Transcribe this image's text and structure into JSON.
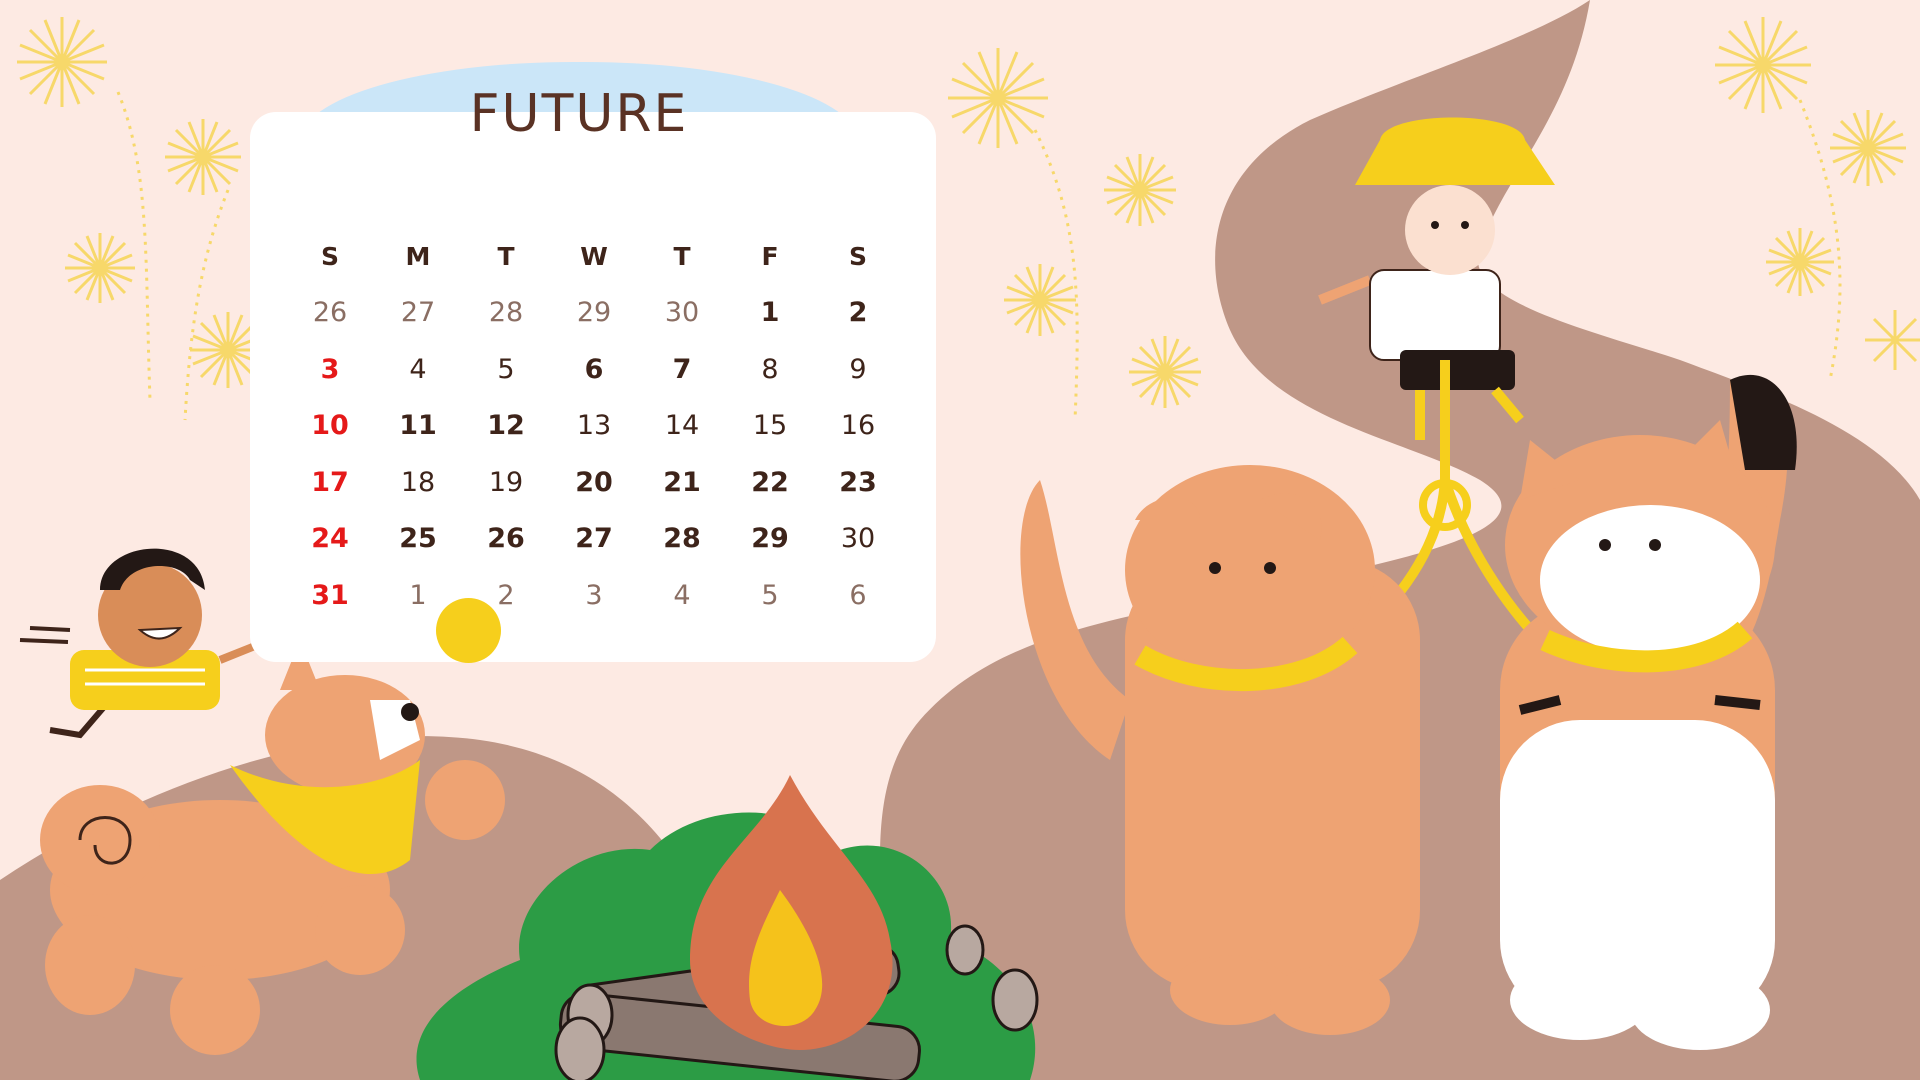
{
  "calendar": {
    "title": "FUTURE",
    "weekdays": [
      "S",
      "M",
      "T",
      "W",
      "T",
      "F",
      "S"
    ],
    "weeks": [
      [
        {
          "d": "26",
          "s": "muted"
        },
        {
          "d": "27",
          "s": "muted"
        },
        {
          "d": "28",
          "s": "muted"
        },
        {
          "d": "29",
          "s": "muted"
        },
        {
          "d": "30",
          "s": "muted"
        },
        {
          "d": "1",
          "s": ""
        },
        {
          "d": "2",
          "s": ""
        }
      ],
      [
        {
          "d": "3",
          "s": "red"
        },
        {
          "d": "4",
          "s": "lite"
        },
        {
          "d": "5",
          "s": "lite"
        },
        {
          "d": "6",
          "s": ""
        },
        {
          "d": "7",
          "s": ""
        },
        {
          "d": "8",
          "s": "lite"
        },
        {
          "d": "9",
          "s": "lite"
        }
      ],
      [
        {
          "d": "10",
          "s": "red"
        },
        {
          "d": "11",
          "s": ""
        },
        {
          "d": "12",
          "s": ""
        },
        {
          "d": "13",
          "s": "lite"
        },
        {
          "d": "14",
          "s": "lite"
        },
        {
          "d": "15",
          "s": "lite"
        },
        {
          "d": "16",
          "s": "lite"
        }
      ],
      [
        {
          "d": "17",
          "s": "red"
        },
        {
          "d": "18",
          "s": "lite"
        },
        {
          "d": "19",
          "s": "lite"
        },
        {
          "d": "20",
          "s": ""
        },
        {
          "d": "21",
          "s": ""
        },
        {
          "d": "22",
          "s": ""
        },
        {
          "d": "23",
          "s": ""
        }
      ],
      [
        {
          "d": "24",
          "s": "red"
        },
        {
          "d": "25",
          "s": ""
        },
        {
          "d": "26",
          "s": ""
        },
        {
          "d": "27",
          "s": ""
        },
        {
          "d": "28",
          "s": ""
        },
        {
          "d": "29",
          "s": ""
        },
        {
          "d": "30",
          "s": "lite"
        }
      ],
      [
        {
          "d": "31",
          "s": "red"
        },
        {
          "d": "1",
          "s": "muted"
        },
        {
          "d": "2",
          "s": "muted"
        },
        {
          "d": "3",
          "s": "muted"
        },
        {
          "d": "4",
          "s": "muted"
        },
        {
          "d": "5",
          "s": "muted"
        },
        {
          "d": "6",
          "s": "muted"
        }
      ]
    ]
  },
  "colors": {
    "background": "#fdeae3",
    "hill": "#bf9787",
    "path": "#b38c7c",
    "sun_ball": "#f6cf1c",
    "cloud": "#cbe6f8",
    "weekend_red": "#e51919",
    "cat_orange": "#eea373",
    "collar_yellow": "#f6cf1c",
    "bush_green": "#2c9c45",
    "flame_outer": "#d8734e",
    "flame_inner": "#f5c21b",
    "firework": "#f7d86a"
  },
  "illustrations": [
    "fireworks",
    "boy-running",
    "shiba-dog-with-bandana",
    "campfire",
    "green-bush",
    "firewood-logs",
    "winding-path",
    "boy-with-bucket-hat-and-leash",
    "orange-fold-cat",
    "calico-cat-with-striped-tail"
  ]
}
